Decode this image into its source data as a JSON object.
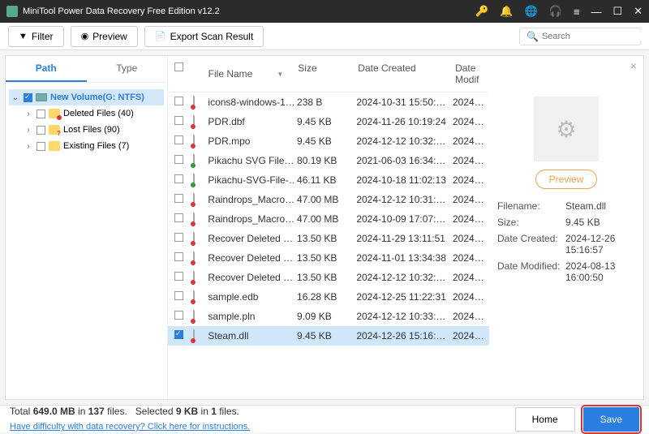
{
  "window": {
    "title": "MiniTool Power Data Recovery Free Edition v12.2"
  },
  "toolbar": {
    "filter": "Filter",
    "preview": "Preview",
    "export": "Export Scan Result",
    "search_placeholder": "Search"
  },
  "tabs": {
    "path": "Path",
    "type": "Type"
  },
  "tree": {
    "root": "New Volume(G: NTFS)",
    "deleted": "Deleted Files (40)",
    "lost": "Lost Files (90)",
    "existing": "Existing Files (7)"
  },
  "columns": {
    "name": "File Name",
    "size": "Size",
    "dc": "Date Created",
    "dm": "Date Modif"
  },
  "files": [
    {
      "name": "icons8-windows-1…",
      "size": "238 B",
      "dc": "2024-10-31 15:50:…",
      "dm": "2024…",
      "ico": "f"
    },
    {
      "name": "PDR.dbf",
      "size": "9.45 KB",
      "dc": "2024-11-26 10:19:24",
      "dm": "2024…",
      "ico": "f"
    },
    {
      "name": "PDR.mpo",
      "size": "9.45 KB",
      "dc": "2024-12-12 10:32:…",
      "dm": "2024…",
      "ico": "f"
    },
    {
      "name": "Pikachu SVG File…",
      "size": "80.19 KB",
      "dc": "2021-06-03 16:34:…",
      "dm": "2024…",
      "ico": "p"
    },
    {
      "name": "Pikachu-SVG-File-…",
      "size": "46.11 KB",
      "dc": "2024-10-18 11:02:13",
      "dm": "2024…",
      "ico": "p"
    },
    {
      "name": "Raindrops_Macro…",
      "size": "47.00 MB",
      "dc": "2024-12-12 10:31:…",
      "dm": "2024…",
      "ico": "f"
    },
    {
      "name": "Raindrops_Macro…",
      "size": "47.00 MB",
      "dc": "2024-10-09 17:07:…",
      "dm": "2024…",
      "ico": "f"
    },
    {
      "name": "Recover Deleted …",
      "size": "13.50 KB",
      "dc": "2024-11-29 13:11:51",
      "dm": "2024…",
      "ico": "f"
    },
    {
      "name": "Recover Deleted …",
      "size": "13.50 KB",
      "dc": "2024-11-01 13:34:38",
      "dm": "2024…",
      "ico": "f"
    },
    {
      "name": "Recover Deleted …",
      "size": "13.50 KB",
      "dc": "2024-12-12 10:32:…",
      "dm": "2024…",
      "ico": "f"
    },
    {
      "name": "sample.edb",
      "size": "16.28 KB",
      "dc": "2024-12-25 11:22:31",
      "dm": "2024…",
      "ico": "f"
    },
    {
      "name": "sample.pln",
      "size": "9.09 KB",
      "dc": "2024-12-12 10:33:…",
      "dm": "2024…",
      "ico": "f"
    },
    {
      "name": "Steam.dll",
      "size": "9.45 KB",
      "dc": "2024-12-26 15:16:…",
      "dm": "2024…",
      "ico": "f"
    }
  ],
  "selected_index": 12,
  "preview": {
    "btn": "Preview",
    "filename_k": "Filename:",
    "filename_v": "Steam.dll",
    "size_k": "Size:",
    "size_v": "9.45 KB",
    "dc_k": "Date Created:",
    "dc_v": "2024-12-26 15:16:57",
    "dm_k": "Date Modified:",
    "dm_v": "2024-08-13 16:00:50"
  },
  "footer": {
    "total_label": "Total ",
    "total_size": "649.0 MB",
    "in1": " in ",
    "total_files": "137",
    "files_label": " files.",
    "sel_label": "Selected ",
    "sel_size": "9 KB",
    "in2": " in ",
    "sel_files": "1",
    "files_label2": " files.",
    "help": "Have difficulty with data recovery? Click here for instructions.",
    "home": "Home",
    "save": "Save"
  }
}
